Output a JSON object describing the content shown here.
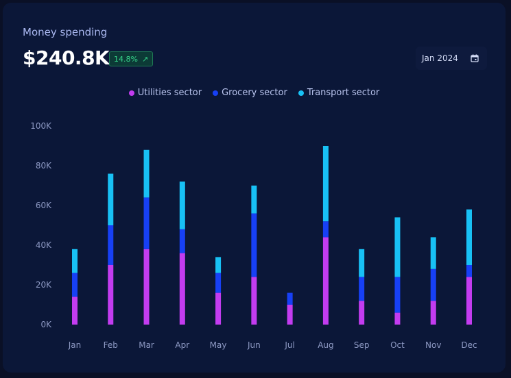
{
  "header": {
    "title": "Money spending",
    "total": "$240.8K",
    "change": "14.8%",
    "change_icon": "arrow-up-right-icon"
  },
  "date_picker": {
    "label": "Jan 2024",
    "icon": "calendar-icon"
  },
  "colors": {
    "utilities": "#c33cf0",
    "grocery": "#1740f5",
    "transport": "#18c1f5",
    "background": "#0b1738"
  },
  "chart_data": {
    "type": "bar",
    "stacked": true,
    "categories": [
      "Jan",
      "Feb",
      "Mar",
      "Apr",
      "May",
      "Jun",
      "Jul",
      "Aug",
      "Sep",
      "Oct",
      "Nov",
      "Dec"
    ],
    "series": [
      {
        "name": "Utilities sector",
        "color": "#c33cf0",
        "values": [
          14000,
          30000,
          38000,
          36000,
          16000,
          24000,
          10000,
          44000,
          12000,
          6000,
          12000,
          24000
        ]
      },
      {
        "name": "Grocery sector",
        "color": "#1740f5",
        "values": [
          12000,
          20000,
          26000,
          12000,
          10000,
          32000,
          6000,
          8000,
          12000,
          18000,
          16000,
          6000
        ]
      },
      {
        "name": "Transport sector",
        "color": "#18c1f5",
        "values": [
          12000,
          26000,
          24000,
          24000,
          8000,
          14000,
          0,
          38000,
          14000,
          30000,
          16000,
          28000
        ]
      }
    ],
    "y_ticks": [
      "0K",
      "20K",
      "40K",
      "60K",
      "80K",
      "100K"
    ],
    "ylim": [
      0,
      100000
    ],
    "legend_position": "top-center",
    "grid": false
  }
}
